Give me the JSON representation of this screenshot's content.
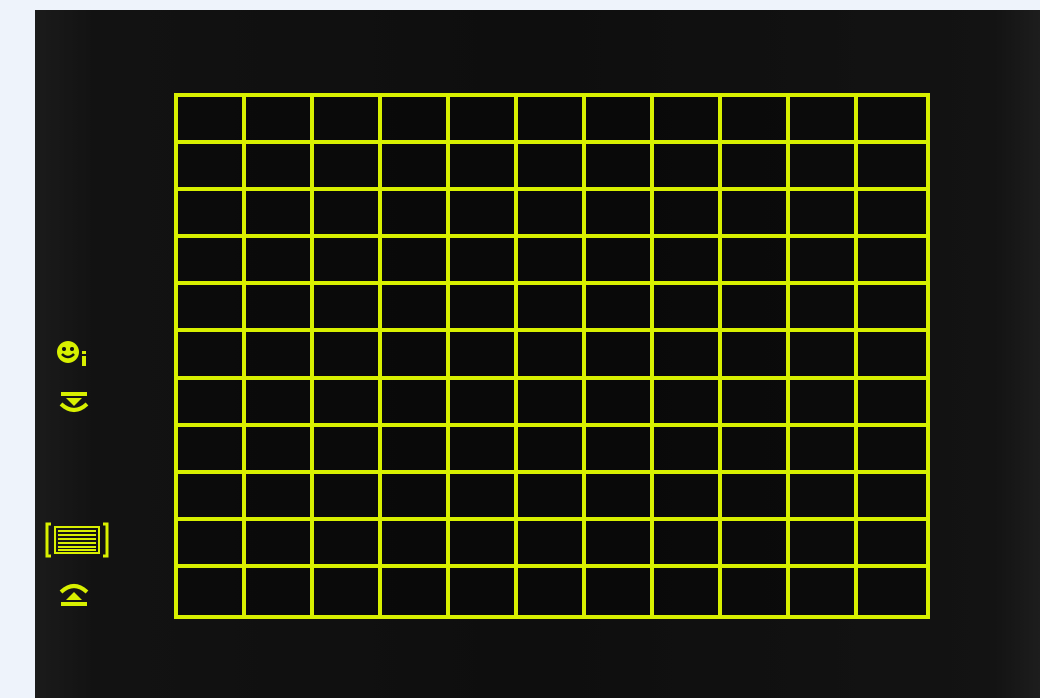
{
  "viewfinder": {
    "screen": "viewfinder-af-grid",
    "grid": {
      "rows": 11,
      "columns": 11
    },
    "accent_color": "#d8f000",
    "background_color": "#101010"
  },
  "side_icons": [
    {
      "name": "face-detect-icon"
    },
    {
      "name": "dial-down-icon"
    },
    {
      "name": "af-area-icon"
    },
    {
      "name": "dial-up-icon"
    }
  ]
}
